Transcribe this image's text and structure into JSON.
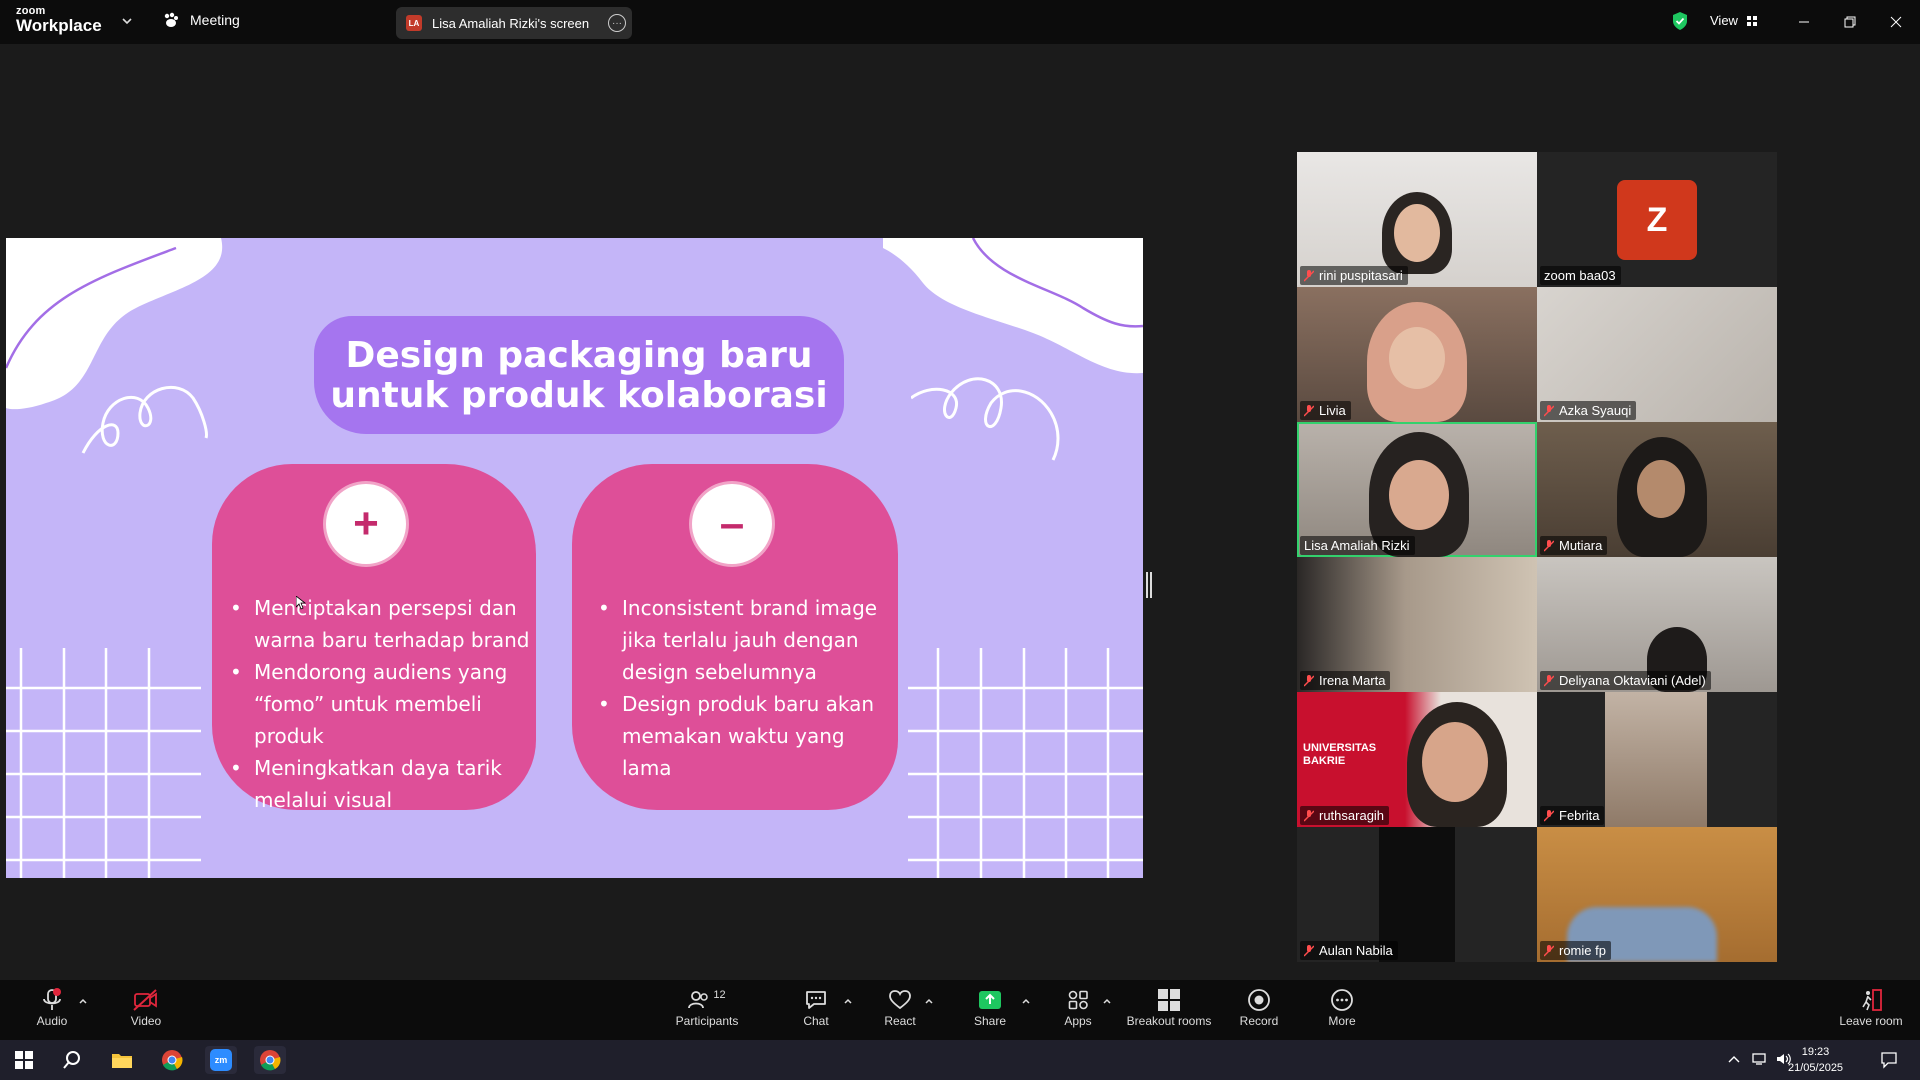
{
  "app": {
    "brand_small": "zoom",
    "brand_big": "Workplace",
    "meeting_label": "Meeting",
    "screen_share_owner": "Lisa Amaliah Rizki's screen",
    "screen_share_initials": "LA",
    "view_label": "View"
  },
  "slide": {
    "title_line1": "Design packaging baru",
    "title_line2": "untuk produk kolaborasi",
    "plus_symbol": "+",
    "minus_symbol": "–",
    "pros": [
      "Menciptakan persepsi dan warna baru terhadap brand",
      "Mendorong audiens yang “fomo” untuk membeli produk",
      "Meningkatkan daya tarik melalui visual"
    ],
    "cons": [
      "Inconsistent brand image jika terlalu jauh dengan design sebelumnya",
      "Design produk baru akan memakan waktu yang lama"
    ]
  },
  "participants": [
    {
      "name": "rini puspitasari",
      "muted": true
    },
    {
      "name": "zoom baa03",
      "muted": false,
      "avatar_letter": "Z"
    },
    {
      "name": "Livia",
      "muted": true
    },
    {
      "name": "Azka Syauqi",
      "muted": true
    },
    {
      "name": "Lisa Amaliah Rizki",
      "muted": false,
      "speaking": true
    },
    {
      "name": "Mutiara",
      "muted": true
    },
    {
      "name": "Irena Marta",
      "muted": true
    },
    {
      "name": "Deliyana Oktaviani (Adel)",
      "muted": true
    },
    {
      "name": "ruthsaragih",
      "muted": true,
      "bg_text": "UNIVERSITAS BAKRIE"
    },
    {
      "name": "Febrita",
      "muted": true
    },
    {
      "name": "Aulan Nabila",
      "muted": true
    },
    {
      "name": "romie fp",
      "muted": true
    }
  ],
  "toolbar": {
    "audio": "Audio",
    "video": "Video",
    "participants": "Participants",
    "participants_count": "12",
    "chat": "Chat",
    "react": "React",
    "share": "Share",
    "apps": "Apps",
    "breakout": "Breakout rooms",
    "record": "Record",
    "more": "More",
    "leave": "Leave room"
  },
  "taskbar": {
    "time": "19:23",
    "date": "21/05/2025"
  },
  "colors": {
    "slide_bg": "#c4b5f8",
    "title_box": "#a575ef",
    "card_pink": "#de4f98",
    "speaking_border": "#33d16d",
    "share_green": "#1ec760"
  }
}
